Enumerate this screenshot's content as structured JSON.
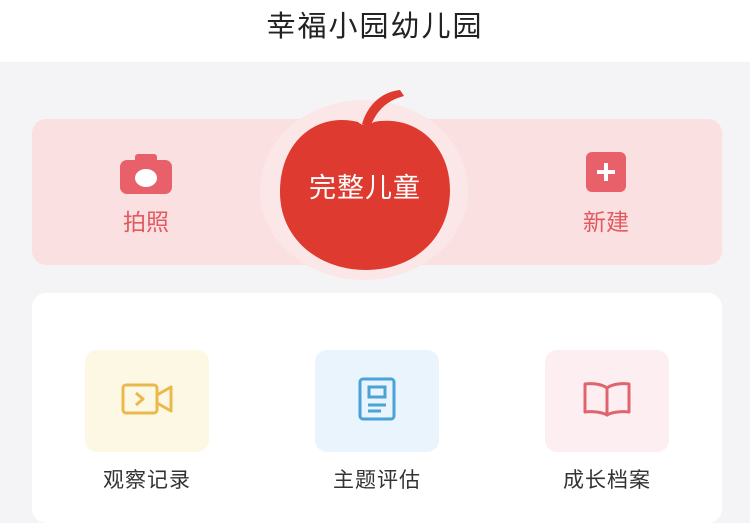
{
  "header": {
    "title": "幸福小园幼儿园"
  },
  "hero": {
    "left": {
      "label": "拍照",
      "icon": "camera-icon"
    },
    "center": {
      "label": "完整儿童",
      "icon": "apple-icon"
    },
    "right": {
      "label": "新建",
      "icon": "plus-square-icon"
    }
  },
  "features": [
    {
      "label": "观察记录",
      "icon": "video-camera-icon",
      "tile_color": "#fdf8e3",
      "icon_color": "#eab84c"
    },
    {
      "label": "主题评估",
      "icon": "document-icon",
      "tile_color": "#eaf4fc",
      "icon_color": "#4aa3d8"
    },
    {
      "label": "成长档案",
      "icon": "book-icon",
      "tile_color": "#fdeff1",
      "icon_color": "#e0646d"
    }
  ],
  "colors": {
    "accent": "#e15a5f",
    "apple": "#df3a2f",
    "hero_bg": "#fbe0e2"
  }
}
